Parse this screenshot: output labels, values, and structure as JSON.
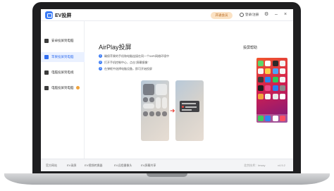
{
  "app": {
    "title": "EV投屏"
  },
  "titlebar": {
    "vip_label": "开通会员",
    "login_label": "登录/注册",
    "icons": [
      "user-icon",
      "settings-icon",
      "minimize-icon",
      "close-icon"
    ]
  },
  "sidebar": {
    "items": [
      {
        "label": "安卓投屏到电脑",
        "icon": "android-icon",
        "active": false
      },
      {
        "label": "苹果投屏到电脑",
        "icon": "apple-icon",
        "active": true
      },
      {
        "label": "电脑投屏到电视",
        "icon": "tv-icon",
        "active": false
      },
      {
        "label": "电脑投屏到电脑",
        "icon": "monitor-icon",
        "active": false,
        "badge": true
      }
    ]
  },
  "main": {
    "title": "AirPlay投屏",
    "steps": [
      "确保苹果的手机和电脑连接在同一个WiFi网络环境中",
      "打开手机控制中心，点击\"屏幕镜像\"",
      "在弹框中选择电脑设备，即可开始投屏"
    ],
    "help_title": "投屏帮助"
  },
  "footer": {
    "links": [
      "官方网站",
      "EV录屏",
      "EV视频转换器",
      "EV远程摄像头",
      "EV屏幕共享"
    ],
    "company": "北京技术：Ieway",
    "version": "v4.5.2"
  },
  "colors": {
    "accent": "#2f6df0",
    "vip_bg": "#fbe2c4",
    "arrow": "#e8453c"
  }
}
